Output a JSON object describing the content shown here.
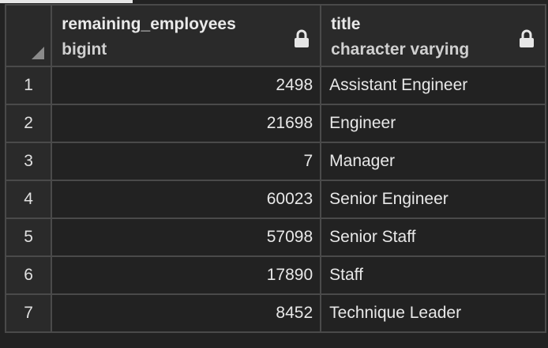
{
  "columns": [
    {
      "name": "remaining_employees",
      "type": "bigint"
    },
    {
      "name": "title",
      "type": "character varying"
    }
  ],
  "icons": {
    "lock": "lock-icon",
    "corner": "sort-corner-icon"
  },
  "rows": [
    {
      "num": "1",
      "remaining_employees": "2498",
      "title": "Assistant Engineer"
    },
    {
      "num": "2",
      "remaining_employees": "21698",
      "title": "Engineer"
    },
    {
      "num": "3",
      "remaining_employees": "7",
      "title": "Manager"
    },
    {
      "num": "4",
      "remaining_employees": "60023",
      "title": "Senior Engineer"
    },
    {
      "num": "5",
      "remaining_employees": "57098",
      "title": "Senior Staff"
    },
    {
      "num": "6",
      "remaining_employees": "17890",
      "title": "Staff"
    },
    {
      "num": "7",
      "remaining_employees": "8452",
      "title": "Technique Leader"
    }
  ]
}
